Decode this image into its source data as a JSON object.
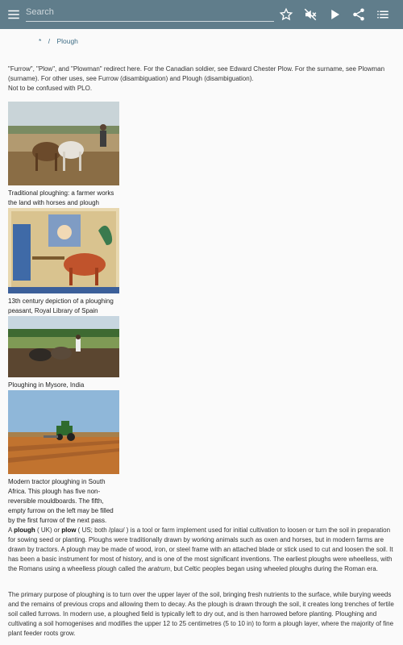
{
  "toolbar": {
    "search_placeholder": "Search",
    "icons": [
      "menu-icon",
      "star-icon",
      "volume-off-icon",
      "play-icon",
      "share-icon",
      "table-of-contents-icon"
    ],
    "background": "#607d8b"
  },
  "breadcrumb": {
    "home": "*",
    "separator": "/",
    "current": "Plough"
  },
  "hatnote": {
    "line1": "\"Furrow\", \"Plow\", and \"Plowman\" redirect here. For the Canadian soldier, see Edward Chester Plow. For the surname, see Plowman (surname). For other uses, see Furrow (disambiguation) and Plough (disambiguation).",
    "line2": "Not to be confused with PLO."
  },
  "figures": [
    {
      "caption": "Traditional ploughing: a farmer works the land with horses and plough"
    },
    {
      "caption": "13th century depiction of a ploughing peasant, Royal Library of Spain"
    },
    {
      "caption": "Ploughing in Mysore, India"
    },
    {
      "caption": "Modern tractor ploughing in South Africa. This plough has five non-reversible mouldboards. The fifth, empty furrow on the left may be filled by the first furrow of the next pass."
    }
  ],
  "article": {
    "p1_a": "A ",
    "p1_plough": "plough",
    "p1_b": " ( UK) or ",
    "p1_plow": "plow",
    "p1_c": " ( US; both /plaʊ/ ) is a tool or farm implement used for initial cultivation to loosen or turn the soil in preparation for sowing seed or planting. Ploughs were traditionally drawn by working animals such as oxen and horses, but in modern farms are drawn by tractors. A plough may be made of wood, iron, or steel frame with an attached blade or stick used to cut and loosen the soil. It has been a basic instrument for most of history, and is one of the most significant inventions. The earliest ploughs were wheelless, with the Romans using a wheelless plough called the ",
    "p1_aratrum": "aratrum",
    "p1_d": ", but Celtic peoples began using wheeled ploughs during the Roman era.",
    "p2": "The primary purpose of ploughing is to turn over the upper layer of the soil, bringing fresh nutrients to the surface, while burying weeds and the remains of previous crops and allowing them to decay. As the plough is drawn through the soil, it creates long trenches of fertile soil called furrows. In modern use, a ploughed field is typically left to dry out, and is then harrowed before planting. Ploughing and cultivating a soil homogenises and modifies the upper 12 to 25 centimetres (5 to 10 in) to form a plough layer, where the majority of fine plant feeder roots grow."
  }
}
